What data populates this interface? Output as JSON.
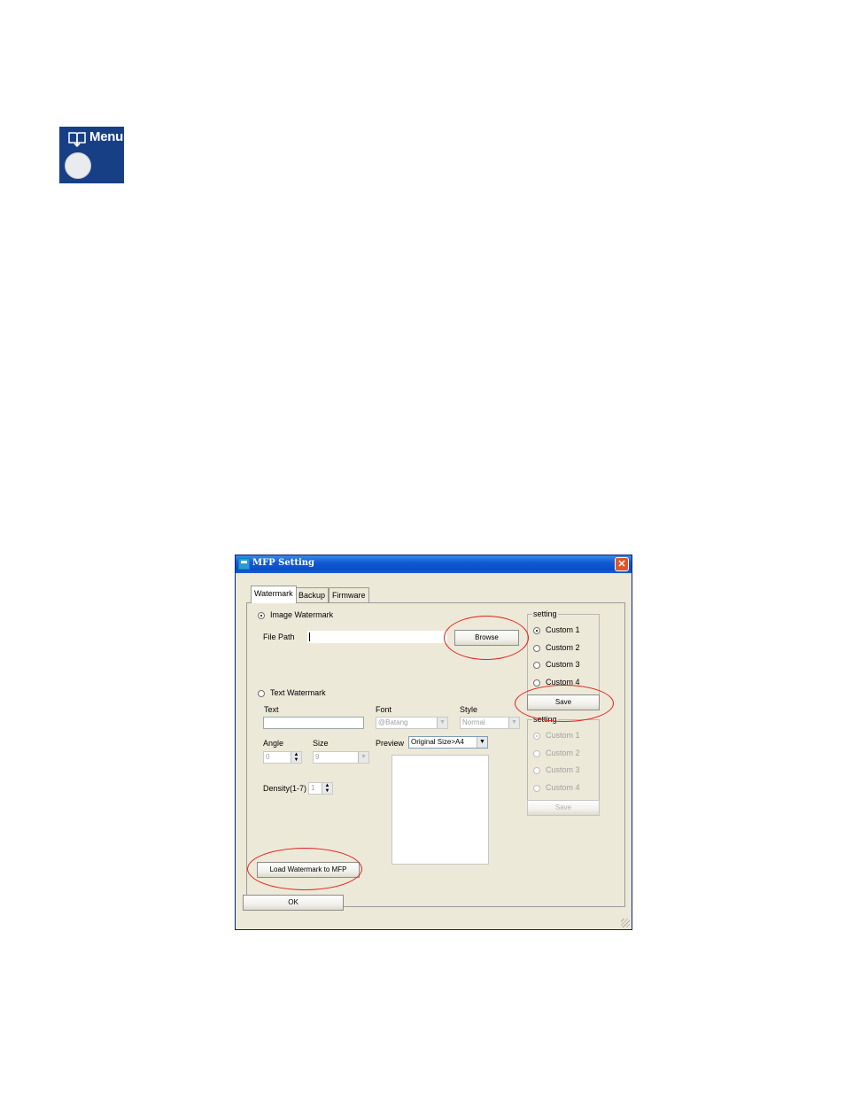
{
  "menu_key": {
    "label": "Menu",
    "icon": "book-icon"
  },
  "window": {
    "title": "MFP Setting",
    "close_label": "✕",
    "tabs": [
      {
        "label": "Watermark",
        "active": true
      },
      {
        "label": "Backup",
        "active": false
      },
      {
        "label": "Firmware",
        "active": false
      }
    ],
    "image_watermark": {
      "radio_label": "Image Watermark",
      "selected": true,
      "file_path_label": "File Path",
      "file_path_value": "",
      "browse_label": "Browse"
    },
    "text_watermark": {
      "radio_label": "Text Watermark",
      "selected": false,
      "text_label": "Text",
      "text_value": "",
      "font_label": "Font",
      "font_value": "@Batang",
      "style_label": "Style",
      "style_value": "Normal",
      "angle_label": "Angle",
      "angle_value": "0",
      "size_label": "Size",
      "size_value": "9",
      "preview_label": "Preview",
      "preview_value": "Original Size>A4",
      "density_label": "Density(1-7)",
      "density_value": "1"
    },
    "setting_top": {
      "label": "setting",
      "options": [
        "Custom 1",
        "Custom 2",
        "Custom 3",
        "Custom 4"
      ],
      "selected": "Custom 1",
      "save_label": "Save"
    },
    "setting_bottom": {
      "label": "setting",
      "options": [
        "Custom 1",
        "Custom 2",
        "Custom 3",
        "Custom 4"
      ],
      "selected": "Custom 1",
      "save_label": "Save"
    },
    "load_button_label": "Load  Watermark to MFP",
    "ok_label": "OK"
  },
  "colors": {
    "menu_key_bg": "#173f86",
    "titlebar": "#0a4ec8",
    "dialog_bg": "#ece9d8",
    "highlight_ellipse": "#e3201b"
  }
}
